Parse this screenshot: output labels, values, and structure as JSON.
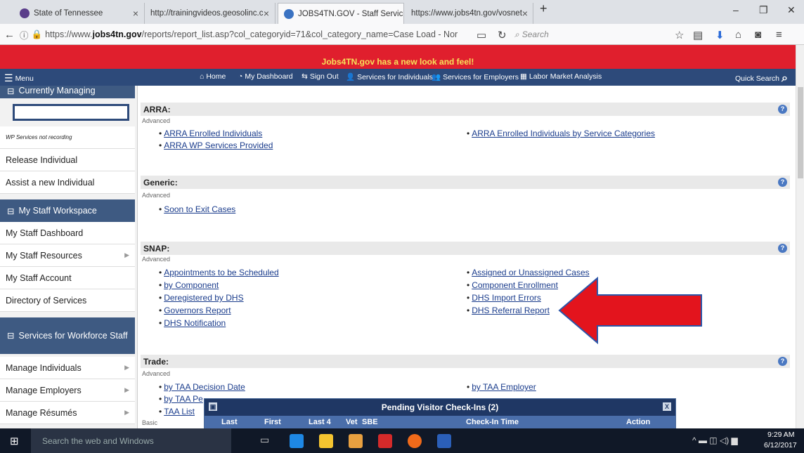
{
  "browser": {
    "tabs": [
      {
        "label": "State of Tennessee"
      },
      {
        "label": "http://trainingvideos.geosolinc.c"
      },
      {
        "label": "JOBS4TN.GOV - Staff Servic"
      },
      {
        "label": "https://www.jobs4tn.gov/vosnet"
      }
    ],
    "url_prefix": "https://www.",
    "url_domain": "jobs4tn.gov",
    "url_path": "/reports/report_list.asp?col_categoryid=71&col_category_name=Case Load - Nor",
    "search_placeholder": "Search"
  },
  "banner": "Jobs4TN.gov has a new look and feel!",
  "nav": {
    "menu": "Menu",
    "items": [
      "Home",
      "My Dashboard",
      "Sign Out",
      "Services for Individuals",
      "Services for Employers",
      "Labor Market Analysis"
    ],
    "quick_search": "Quick Search"
  },
  "sidebar": {
    "managing_header": "Currently Managing",
    "wp_note": "WP Services not recording",
    "release": "Release Individual",
    "assist": "Assist a new Individual",
    "workspace_header": "My Staff Workspace",
    "workspace_items": [
      "My Staff Dashboard",
      "My Staff Resources",
      "My Staff Account",
      "Directory of Services"
    ],
    "workforce_header": "Services for Workforce Staff",
    "workforce_items": [
      "Manage Individuals",
      "Manage Employers",
      "Manage Résumés"
    ]
  },
  "sections": {
    "arra": {
      "title": "ARRA:",
      "tag": "Advanced",
      "links": [
        "ARRA Enrolled Individuals",
        "ARRA WP Services Provided",
        "ARRA Enrolled Individuals by Service Categories"
      ]
    },
    "generic": {
      "title": "Generic:",
      "tag": "Advanced",
      "links": [
        "Soon to Exit Cases"
      ]
    },
    "snap": {
      "title": "SNAP:",
      "tag": "Advanced",
      "left": [
        "Appointments to be Scheduled",
        "by Component",
        "Deregistered by DHS",
        "Governors Report",
        "DHS Notification"
      ],
      "right": [
        "Assigned or Unassigned Cases",
        "Component Enrollment",
        "DHS Import Errors",
        "DHS Referral Report"
      ]
    },
    "trade": {
      "title": "Trade:",
      "tag": "Advanced",
      "links": [
        "by TAA Decision Date",
        "by TAA Pe",
        "TAA List",
        "by TAA Employer"
      ],
      "basic_tag": "Basic"
    }
  },
  "popup": {
    "title": "Pending Visitor Check-Ins (2)",
    "close": "X",
    "columns": [
      "Last",
      "First",
      "Last 4",
      "Vet",
      "SBE",
      "Check-In Time",
      "Action"
    ]
  },
  "taskbar": {
    "search": "Search the web and Windows",
    "time": "9:29 AM",
    "date": "6/12/2017"
  },
  "colors": {
    "banner": "#e01f2d",
    "nav": "#2d4a7a",
    "arrow": "#e3141d"
  }
}
